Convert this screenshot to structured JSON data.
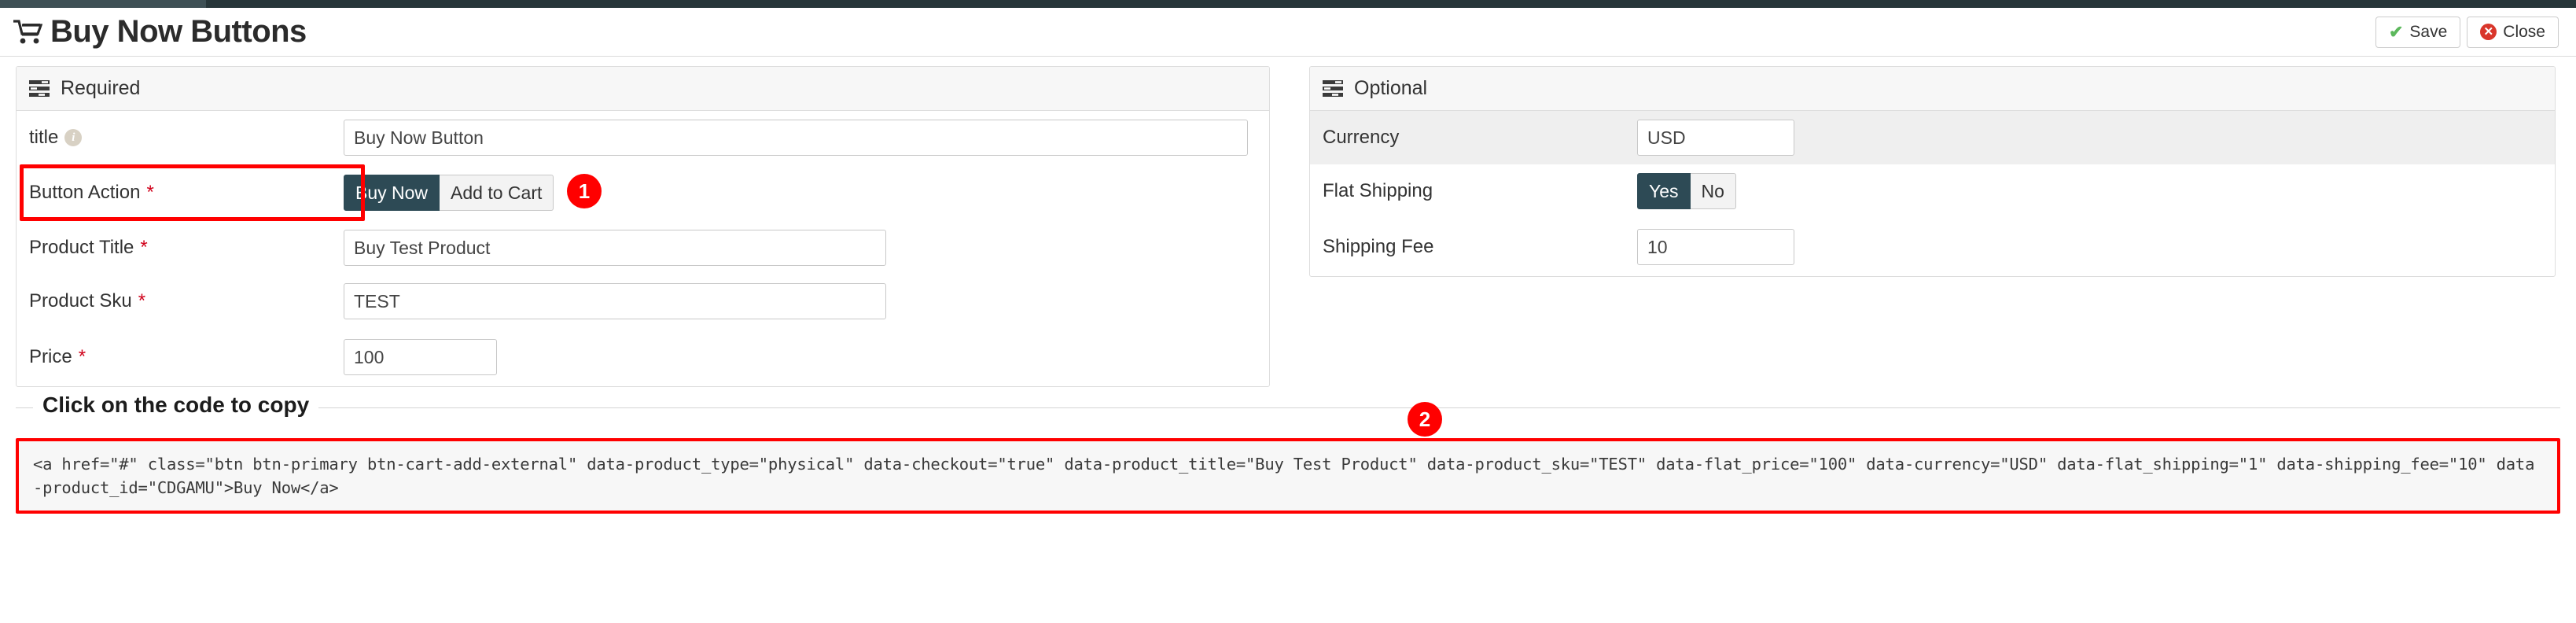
{
  "header": {
    "title": "Buy Now Buttons",
    "cart_icon": "shopping-cart-icon",
    "save_label": "Save",
    "close_label": "Close",
    "save_icon": "check-icon",
    "close_icon": "x-circle-icon"
  },
  "required_panel": {
    "heading": "Required",
    "heading_icon": "list-stack-icon",
    "fields": {
      "title": {
        "label": "title",
        "info_icon": "info-icon",
        "value": "Buy Now Button",
        "required": false
      },
      "button_action": {
        "label": "Button Action",
        "required": true,
        "required_marker": "*",
        "options": [
          "Buy Now",
          "Add to Cart"
        ],
        "selected": "Buy Now"
      },
      "product_title": {
        "label": "Product Title",
        "required": true,
        "required_marker": "*",
        "value": "Buy Test Product"
      },
      "product_sku": {
        "label": "Product Sku",
        "required": true,
        "required_marker": "*",
        "value": "TEST"
      },
      "price": {
        "label": "Price",
        "required": true,
        "required_marker": "*",
        "value": "100"
      }
    }
  },
  "optional_panel": {
    "heading": "Optional",
    "heading_icon": "list-stack-icon",
    "fields": {
      "currency": {
        "label": "Currency",
        "value": "USD"
      },
      "flat_shipping": {
        "label": "Flat Shipping",
        "options": [
          "Yes",
          "No"
        ],
        "selected": "Yes"
      },
      "shipping_fee": {
        "label": "Shipping Fee",
        "value": "10"
      }
    }
  },
  "code_section": {
    "legend": "Click on the code to copy",
    "snippet": "<a href=\"#\" class=\"btn btn-primary btn-cart-add-external\" data-product_type=\"physical\" data-checkout=\"true\" data-product_title=\"Buy Test Product\" data-product_sku=\"TEST\" data-flat_price=\"100\" data-currency=\"USD\" data-flat_shipping=\"1\" data-shipping_fee=\"10\" data-product_id=\"CDGAMU\">Buy Now</a>"
  },
  "annotations": {
    "badge_1": "1",
    "badge_2": "2"
  },
  "colors": {
    "accent_dark": "#2d4a55",
    "highlight_red": "#ff0000",
    "required_red": "#d0021b",
    "save_green": "#5cb85c",
    "close_red": "#d9362b"
  }
}
